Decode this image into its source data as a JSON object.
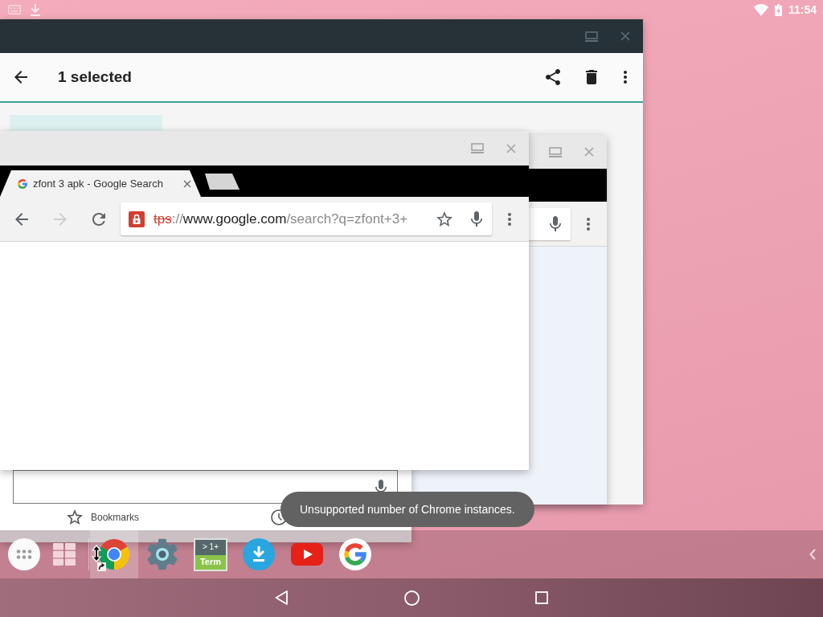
{
  "status_bar": {
    "time": "11:54"
  },
  "files_window": {
    "title": "1 selected",
    "items": [
      {
        "selected": true
      }
    ]
  },
  "browser_window": {
    "tabs": [
      {
        "title": "zfont 3 apk - Google Search",
        "selected": true
      }
    ],
    "nav_buttons": [
      {
        "kind": "back",
        "disabled": false
      },
      {
        "kind": "forward",
        "disabled": true
      },
      {
        "kind": "reload",
        "disabled": false
      }
    ],
    "address": {
      "secure": false,
      "scheme": "tps",
      "separator": "://",
      "host": "www.google.com",
      "path": "/search?q=zfont+3+"
    }
  },
  "new_tab_window": {
    "bookmarks_label": "Bookmarks"
  },
  "taskbar": {
    "launchers": [
      {
        "kind": "all-apps"
      },
      {
        "kind": "grid"
      }
    ],
    "pinned_apps": [
      {
        "kind": "chrome",
        "selected": true
      },
      {
        "kind": "settings",
        "selected": false
      },
      {
        "kind": "terminal",
        "selected": false,
        "icon_text": {
          "top": "> 1+",
          "bottom": "Term"
        }
      },
      {
        "kind": "download",
        "selected": false
      },
      {
        "kind": "youtube",
        "selected": false
      },
      {
        "kind": "google",
        "selected": false
      }
    ]
  },
  "toast": {
    "message": "Unsupported number of Chrome instances."
  }
}
